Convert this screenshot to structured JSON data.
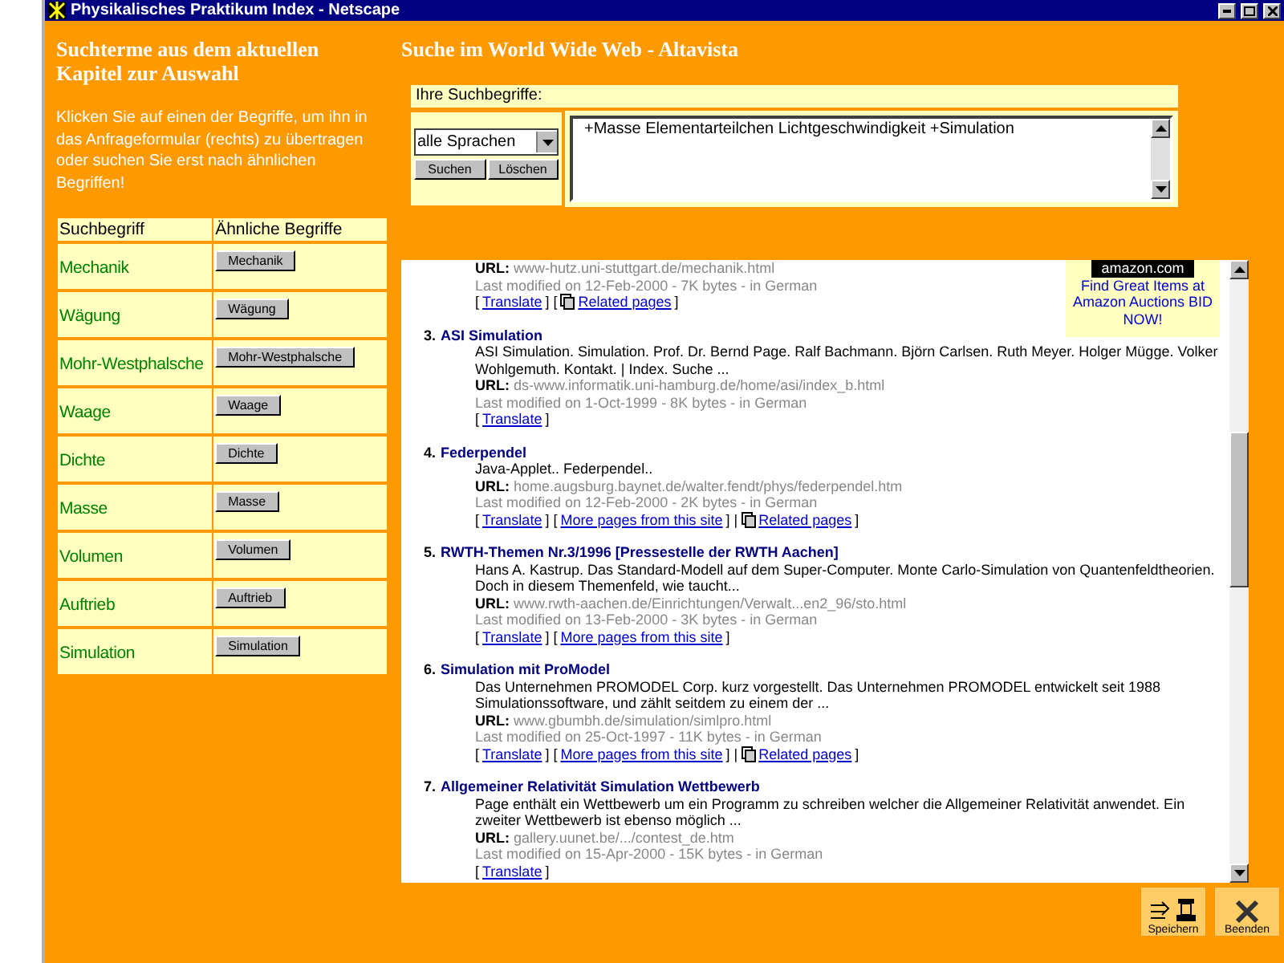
{
  "window": {
    "title": "Physikalisches Praktikum Index - Netscape"
  },
  "left_panel": {
    "heading": "Suchterme aus dem aktuellen Kapitel zur Auswahl",
    "intro": "Klicken Sie auf einen der Begriffe, um ihn in das Anfrageformular (rechts) zu übertragen oder suchen Sie erst nach ähnlichen Begriffen!",
    "table": {
      "columns": [
        "Suchbegriff",
        "Ähnliche Begriffe"
      ],
      "rows": [
        {
          "term": "Mechanik",
          "similar": "Mechanik"
        },
        {
          "term": "Wägung",
          "similar": "Wägung"
        },
        {
          "term": "Mohr-Westphalsche",
          "similar": "Mohr-Westphalsche"
        },
        {
          "term": "Waage",
          "similar": "Waage"
        },
        {
          "term": "Dichte",
          "similar": "Dichte"
        },
        {
          "term": "Masse",
          "similar": "Masse"
        },
        {
          "term": "Volumen",
          "similar": "Volumen"
        },
        {
          "term": "Auftrieb",
          "similar": "Auftrieb"
        },
        {
          "term": "Simulation",
          "similar": "Simulation"
        }
      ]
    }
  },
  "search": {
    "heading": "Suche im World Wide Web - Altavista",
    "label": "Ihre Suchbegriffe:",
    "language": "alle Sprachen",
    "buttons": [
      "Suchen",
      "Löschen"
    ],
    "query": "+Masse Elementarteilchen Lichtgeschwindigkeit +Simulation"
  },
  "results": {
    "ad": {
      "logo": "amazon.com",
      "link": "Find Great Items at Amazon Auctions BID NOW!"
    },
    "items": [
      {
        "url_label": "URL:",
        "url": "www-hutz.uni-stuttgart.de/mechanik.html",
        "modified": "Last modified on 12-Feb-2000 - 7K bytes - in German",
        "links": [
          {
            "kind": "text",
            "text": "["
          },
          {
            "kind": "link",
            "text": "Translate"
          },
          {
            "kind": "text",
            "text": "] ["
          },
          {
            "kind": "related",
            "text": "Related pages"
          },
          {
            "kind": "text",
            "text": "]"
          }
        ]
      },
      {
        "number": "3.",
        "title": "ASI Simulation",
        "url_label": "URL:",
        "snippet": "ASI Simulation. Simulation. Prof. Dr. Bernd Page. Ralf Bachmann. Björn Carlsen. Ruth Meyer. Holger Mügge. Volker Wohlgemuth. Kontakt. | Index. Suche ...",
        "url": "ds-www.informatik.uni-hamburg.de/home/asi/index_b.html",
        "modified": "Last modified on 1-Oct-1999 - 8K bytes - in German",
        "links": [
          {
            "kind": "text",
            "text": "["
          },
          {
            "kind": "link",
            "text": "Translate"
          },
          {
            "kind": "text",
            "text": "]"
          }
        ]
      },
      {
        "number": "4.",
        "title": "Federpendel",
        "url_label": "URL:",
        "snippet": "Java-Applet.. Federpendel..",
        "url": "home.augsburg.baynet.de/walter.fendt/phys/federpendel.htm",
        "modified": "Last modified on 12-Feb-2000 - 2K bytes - in German",
        "links": [
          {
            "kind": "text",
            "text": "["
          },
          {
            "kind": "link",
            "text": "Translate"
          },
          {
            "kind": "text",
            "text": "] ["
          },
          {
            "kind": "link",
            "text": "More pages from this site"
          },
          {
            "kind": "text",
            "text": "] |"
          },
          {
            "kind": "related",
            "text": "Related pages"
          },
          {
            "kind": "text",
            "text": "]"
          }
        ]
      },
      {
        "number": "5.",
        "title": "RWTH-Themen Nr.3/1996 [Pressestelle der RWTH Aachen]",
        "url_label": "URL:",
        "snippet": "Hans A. Kastrup. Das Standard-Modell auf dem Super-Computer. Monte Carlo-Simulation von Quantenfeldtheorien. Doch in diesem Themenfeld, wie taucht...",
        "url": "www.rwth-aachen.de/Einrichtungen/Verwalt...en2_96/sto.html",
        "modified": "Last modified on 13-Feb-2000 - 3K bytes - in German",
        "links": [
          {
            "kind": "text",
            "text": "["
          },
          {
            "kind": "link",
            "text": "Translate"
          },
          {
            "kind": "text",
            "text": "] ["
          },
          {
            "kind": "link",
            "text": "More pages from this site"
          },
          {
            "kind": "text",
            "text": "]"
          }
        ]
      },
      {
        "number": "6.",
        "title": "Simulation mit ProModel",
        "url_label": "URL:",
        "snippet": "Das Unternehmen PROMODEL Corp. kurz vorgestellt. Das Unternehmen PROMODEL entwickelt seit 1988 Simulationssoftware, und zählt seitdem zu einem der ...",
        "url": "www.gbumbh.de/simulation/simlpro.html",
        "modified": "Last modified on 25-Oct-1997 - 11K bytes - in German",
        "links": [
          {
            "kind": "text",
            "text": "["
          },
          {
            "kind": "link",
            "text": "Translate"
          },
          {
            "kind": "text",
            "text": "] ["
          },
          {
            "kind": "link",
            "text": "More pages from this site"
          },
          {
            "kind": "text",
            "text": "] |"
          },
          {
            "kind": "related",
            "text": "Related pages"
          },
          {
            "kind": "text",
            "text": "]"
          }
        ]
      },
      {
        "number": "7.",
        "title": "Allgemeiner Relativität Simulation Wettbewerb",
        "url_label": "URL:",
        "snippet": "Page enthält ein Wettbewerb um ein Programm zu schreiben welcher die Allgemeiner Relativität anwendet. Ein zweiter Wettbewerb ist ebenso möglich ...",
        "url": "gallery.uunet.be/.../contest_de.htm",
        "modified": "Last modified on 15-Apr-2000 - 15K bytes - in German",
        "links": [
          {
            "kind": "text",
            "text": "["
          },
          {
            "kind": "link",
            "text": "Translate"
          },
          {
            "kind": "text",
            "text": "]"
          }
        ]
      }
    ]
  },
  "actions": [
    {
      "kind": "save",
      "label": "Speichern"
    },
    {
      "kind": "quit",
      "label": "Beenden"
    }
  ]
}
